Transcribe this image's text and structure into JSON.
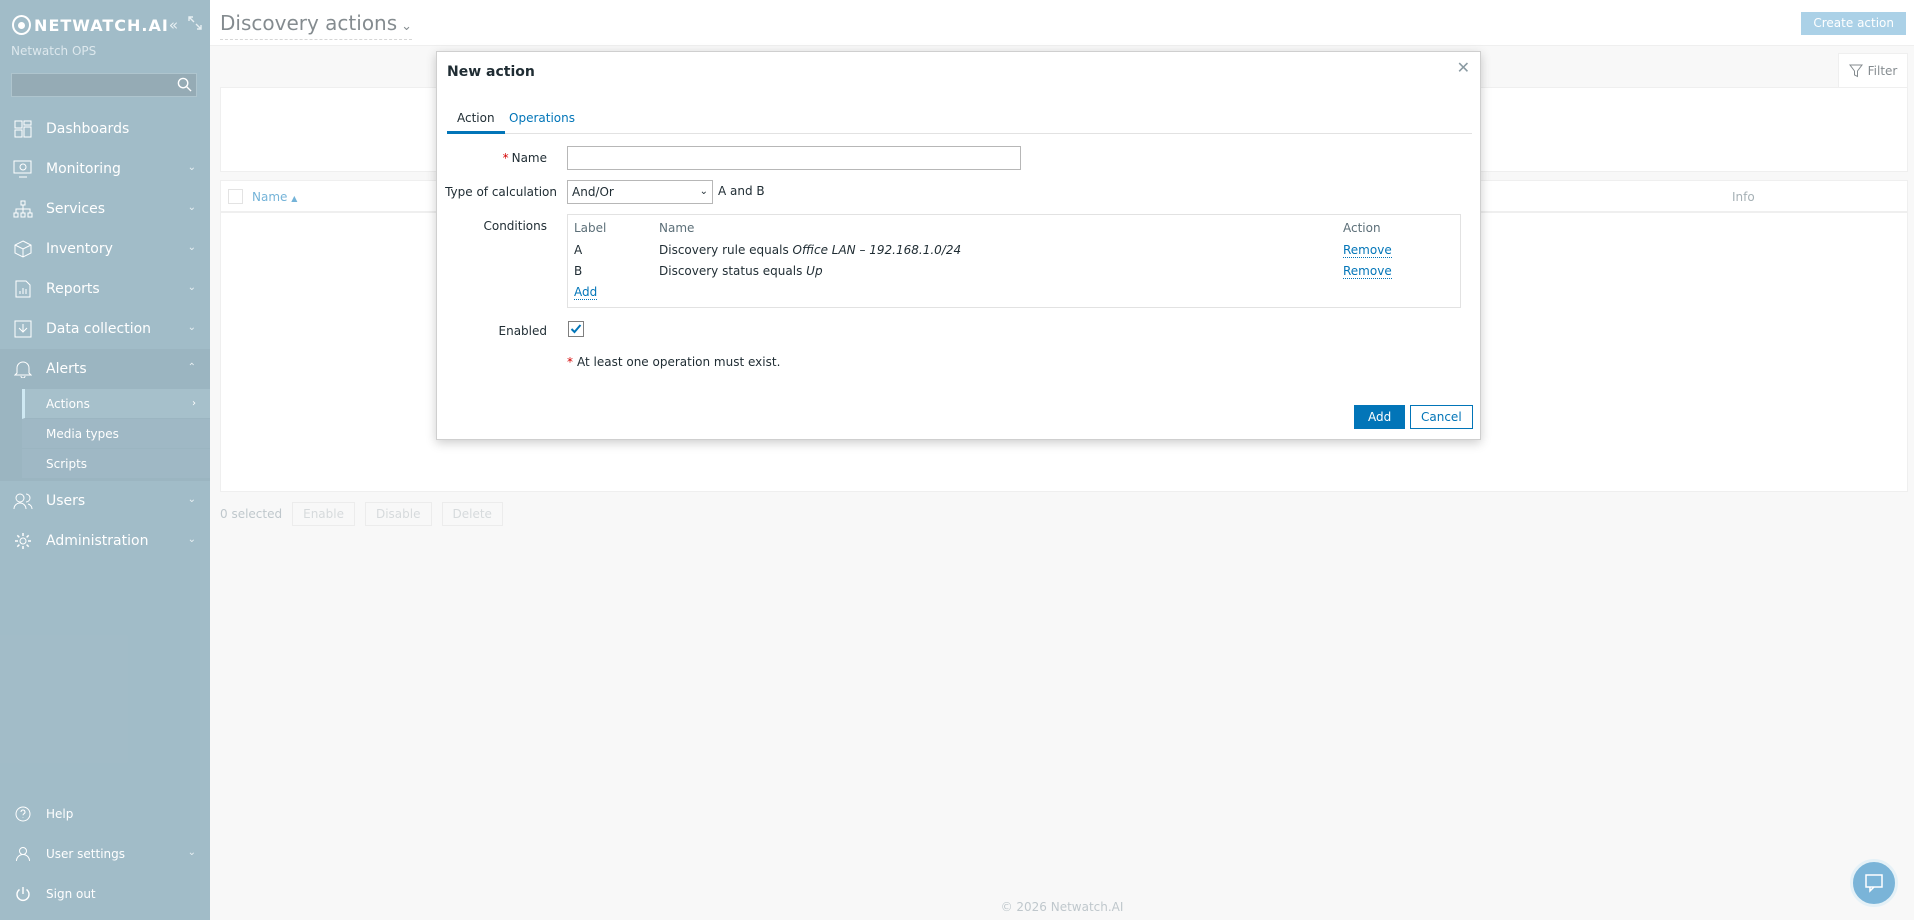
{
  "brand": {
    "logo_text": "NETWATCH.AI",
    "org_name": "Netwatch OPS"
  },
  "sidebar": {
    "search_placeholder": "",
    "items": [
      {
        "label": "Dashboards",
        "icon": "dashboards-icon"
      },
      {
        "label": "Monitoring",
        "icon": "monitoring-icon"
      },
      {
        "label": "Services",
        "icon": "services-icon"
      },
      {
        "label": "Inventory",
        "icon": "inventory-icon"
      },
      {
        "label": "Reports",
        "icon": "reports-icon"
      },
      {
        "label": "Data collection",
        "icon": "data-collection-icon"
      },
      {
        "label": "Alerts",
        "icon": "bell-icon"
      },
      {
        "label": "Users",
        "icon": "users-icon"
      },
      {
        "label": "Administration",
        "icon": "gear-icon"
      }
    ],
    "alerts_sub": [
      {
        "label": "Actions"
      },
      {
        "label": "Media types"
      },
      {
        "label": "Scripts"
      }
    ],
    "bottom": [
      {
        "label": "Help"
      },
      {
        "label": "User settings"
      },
      {
        "label": "Sign out"
      }
    ]
  },
  "header": {
    "title": "Discovery actions",
    "create_label": "Create action"
  },
  "filter": {
    "label": "Filter"
  },
  "table": {
    "col_name": "Name",
    "col_info": "Info"
  },
  "bulk": {
    "selected": "0 selected",
    "enable": "Enable",
    "disable": "Disable",
    "delete": "Delete"
  },
  "footer": {
    "copyright": "© 2026 Netwatch.AI"
  },
  "modal": {
    "title": "New action",
    "tabs": {
      "action": "Action",
      "operations": "Operations"
    },
    "name_label": "Name",
    "name_value": "",
    "calc_label": "Type of calculation",
    "calc_value": "And/Or",
    "calc_expr": "A and B",
    "conditions_label": "Conditions",
    "cond_headers": {
      "label": "Label",
      "name": "Name",
      "action": "Action"
    },
    "conditions": [
      {
        "label": "A",
        "name_prefix": "Discovery rule equals ",
        "name_value": "Office LAN – 192.168.1.0/24",
        "action": "Remove"
      },
      {
        "label": "B",
        "name_prefix": "Discovery status equals ",
        "name_value": "Up",
        "action": "Remove"
      }
    ],
    "cond_add": "Add",
    "enabled_label": "Enabled",
    "enabled": true,
    "note": "At least one operation must exist.",
    "btn_add": "Add",
    "btn_cancel": "Cancel"
  },
  "colors": {
    "sidebar": "#55859b",
    "accent": "#0275b8",
    "required": "#d40000"
  }
}
